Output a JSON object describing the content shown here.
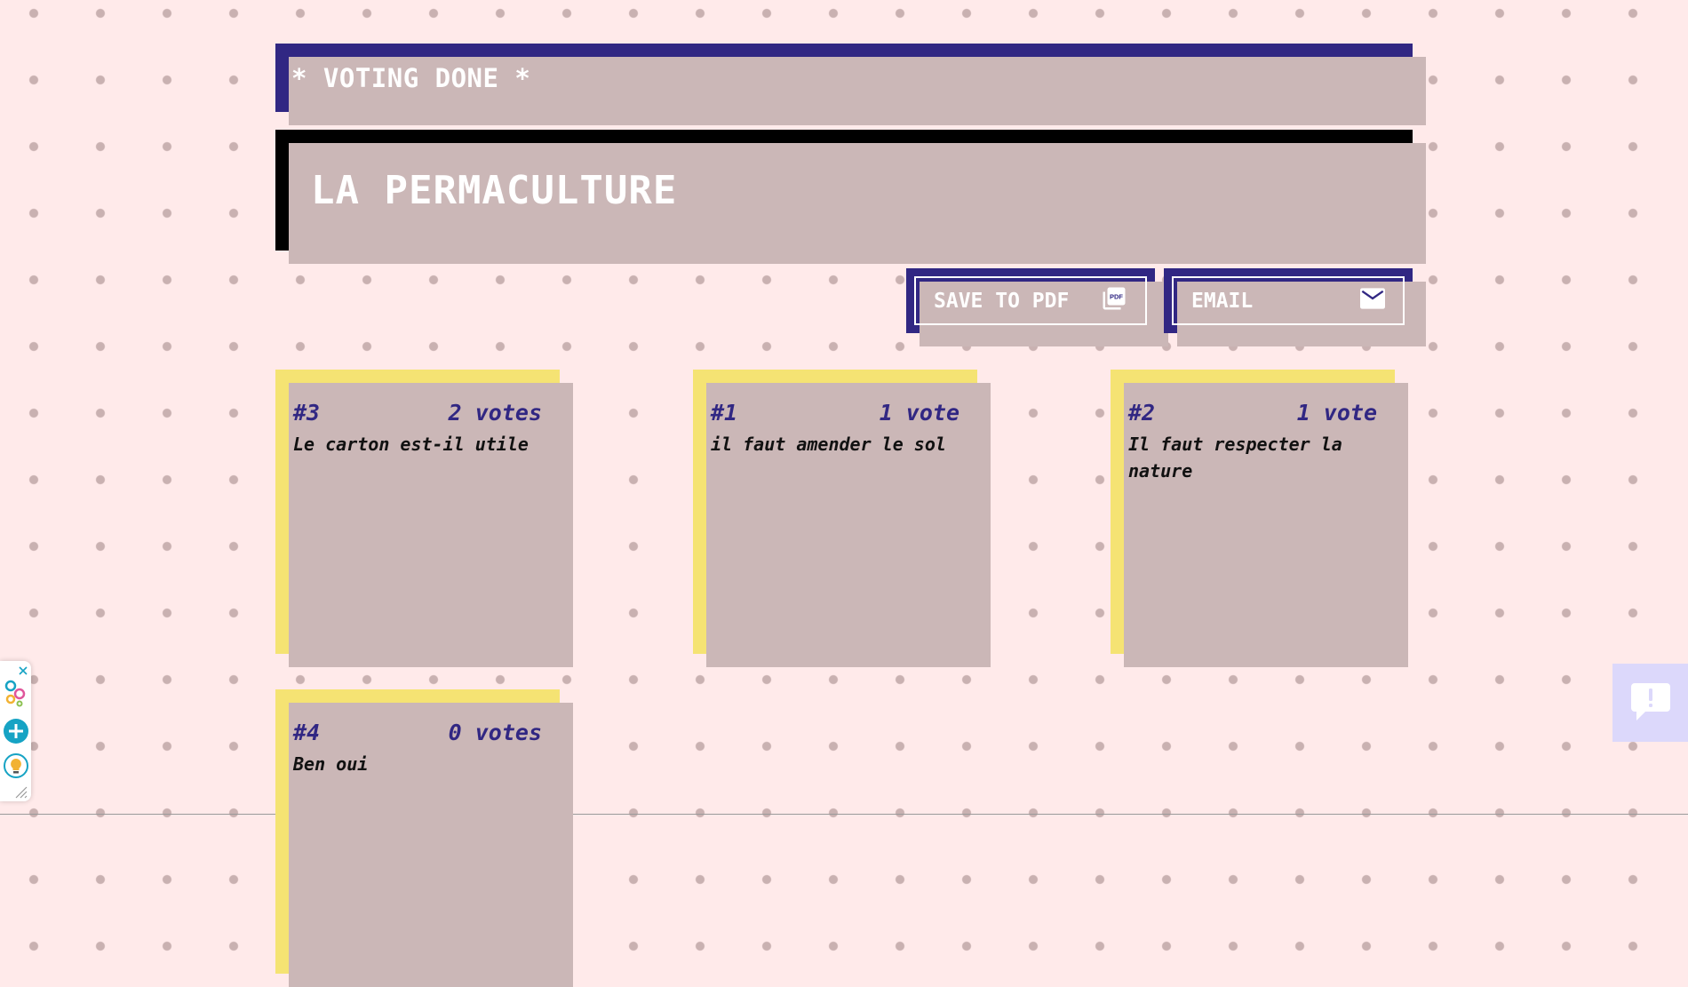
{
  "header": {
    "status": "* VOTING DONE *",
    "title": "LA PERMACULTURE"
  },
  "actions": {
    "save_pdf_label": "SAVE TO PDF",
    "email_label": "EMAIL"
  },
  "notes": [
    {
      "rank": "#3",
      "votes": "2 votes",
      "text": "Le carton est-il utile"
    },
    {
      "rank": "#1",
      "votes": "1 vote",
      "text": "il faut amender le sol"
    },
    {
      "rank": "#2",
      "votes": "1 vote",
      "text": "Il faut respecter la nature"
    },
    {
      "rank": "#4",
      "votes": "0 votes",
      "text": "Ben oui"
    }
  ],
  "icons": {
    "pdf": "pdf-icon",
    "email": "mail-icon",
    "feedback": "feedback-icon"
  },
  "colors": {
    "background": "#ffeaea",
    "primary": "#312783",
    "note": "#f5e373",
    "title_bg": "#000000"
  }
}
